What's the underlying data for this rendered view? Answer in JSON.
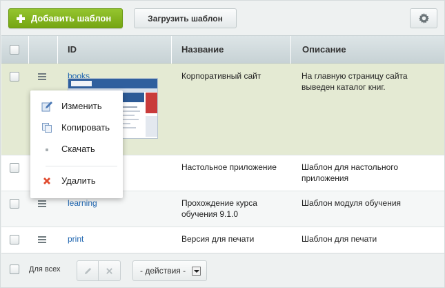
{
  "toolbar": {
    "add_label": "Добавить шаблон",
    "load_label": "Загрузить шаблон",
    "settings_icon": "gear-icon"
  },
  "table": {
    "columns": [
      "ID",
      "Название",
      "Описание"
    ],
    "rows": [
      {
        "id": "books",
        "name": "Корпоративный сайт",
        "description": [
          "На главную страницу сайта",
          "выведен каталог книг."
        ],
        "highlighted": true,
        "has_thumbnail": true
      },
      {
        "id": "",
        "name": "Настольное приложение",
        "description": [
          "Шаблон для настольного",
          "приложения"
        ],
        "highlighted": false
      },
      {
        "id": "learning",
        "name": [
          "Прохождение курса",
          "обучения 9.1.0"
        ],
        "description": [
          "Шаблон модуля обучения"
        ],
        "highlighted": false
      },
      {
        "id": "print",
        "name": "Версия для печати",
        "description": [
          "Шаблон для печати"
        ],
        "highlighted": false
      }
    ]
  },
  "context_menu": {
    "items": [
      {
        "label": "Изменить",
        "icon": "edit-icon"
      },
      {
        "label": "Копировать",
        "icon": "copy-icon"
      },
      {
        "label": "Скачать",
        "icon": "download-dot-icon"
      },
      {
        "label": "Удалить",
        "icon": "delete-icon"
      }
    ]
  },
  "footer": {
    "for_all_label": "Для всех",
    "actions_select": "- действия -"
  },
  "colors": {
    "accent_green": "#80b11b",
    "link": "#2066b0",
    "highlight_row": "#e4ead3",
    "delete_red": "#e04b2f"
  }
}
